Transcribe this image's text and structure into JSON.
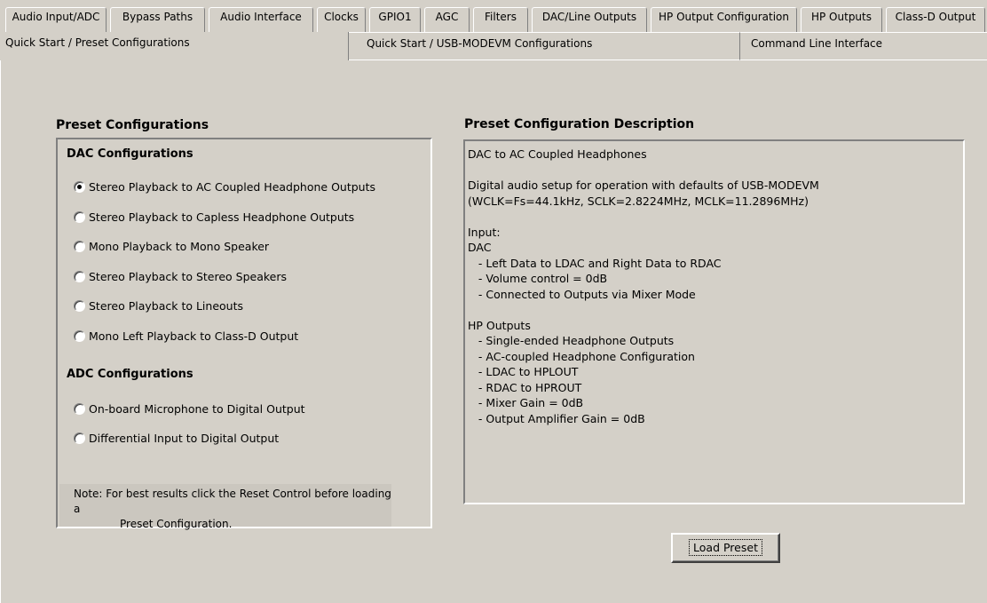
{
  "top_tabs": [
    {
      "label": "Audio Input/ADC"
    },
    {
      "label": "Bypass Paths"
    },
    {
      "label": "Audio Interface"
    },
    {
      "label": "Clocks"
    },
    {
      "label": "GPIO1"
    },
    {
      "label": "AGC"
    },
    {
      "label": "Filters"
    },
    {
      "label": "DAC/Line Outputs"
    },
    {
      "label": "HP Output Configuration"
    },
    {
      "label": "HP Outputs"
    },
    {
      "label": "Class-D Output"
    }
  ],
  "sub_tabs": [
    {
      "label": "Quick Start / Preset Configurations",
      "active": true
    },
    {
      "label": "Quick Start / USB-MODEVM Configurations",
      "active": false
    },
    {
      "label": "Command Line Interface",
      "active": false
    }
  ],
  "preset": {
    "section_title": "Preset Configurations",
    "dac_group_title": "DAC Configurations",
    "dac_options": [
      {
        "label": "Stereo Playback to AC Coupled Headphone Outputs",
        "checked": true
      },
      {
        "label": "Stereo Playback to Capless Headphone Outputs",
        "checked": false
      },
      {
        "label": "Mono Playback to Mono Speaker",
        "checked": false
      },
      {
        "label": "Stereo Playback to Stereo Speakers",
        "checked": false
      },
      {
        "label": "Stereo Playback to Lineouts",
        "checked": false
      },
      {
        "label": "Mono Left Playback to Class-D Output",
        "checked": false
      }
    ],
    "adc_group_title": "ADC Configurations",
    "adc_options": [
      {
        "label": "On-board Microphone to Digital Output",
        "checked": false
      },
      {
        "label": "Differential Input to Digital Output",
        "checked": false
      }
    ],
    "note_line1": "Note: For best results click the Reset Control before loading a",
    "note_line2": "Preset Configuration."
  },
  "description": {
    "section_title": "Preset Configuration Description",
    "text": "DAC to AC Coupled Headphones\n\nDigital audio setup for operation with defaults of USB-MODEVM\n(WCLK=Fs=44.1kHz, SCLK=2.8224MHz, MCLK=11.2896MHz)\n\nInput:\nDAC\n   - Left Data to LDAC and Right Data to RDAC\n   - Volume control = 0dB\n   - Connected to Outputs via Mixer Mode\n\nHP Outputs\n   - Single-ended Headphone Outputs\n   - AC-coupled Headphone Configuration\n   - LDAC to HPLOUT\n   - RDAC to HPROUT\n   - Mixer Gain = 0dB\n   - Output Amplifier Gain = 0dB"
  },
  "load_button_label": "Load Preset"
}
